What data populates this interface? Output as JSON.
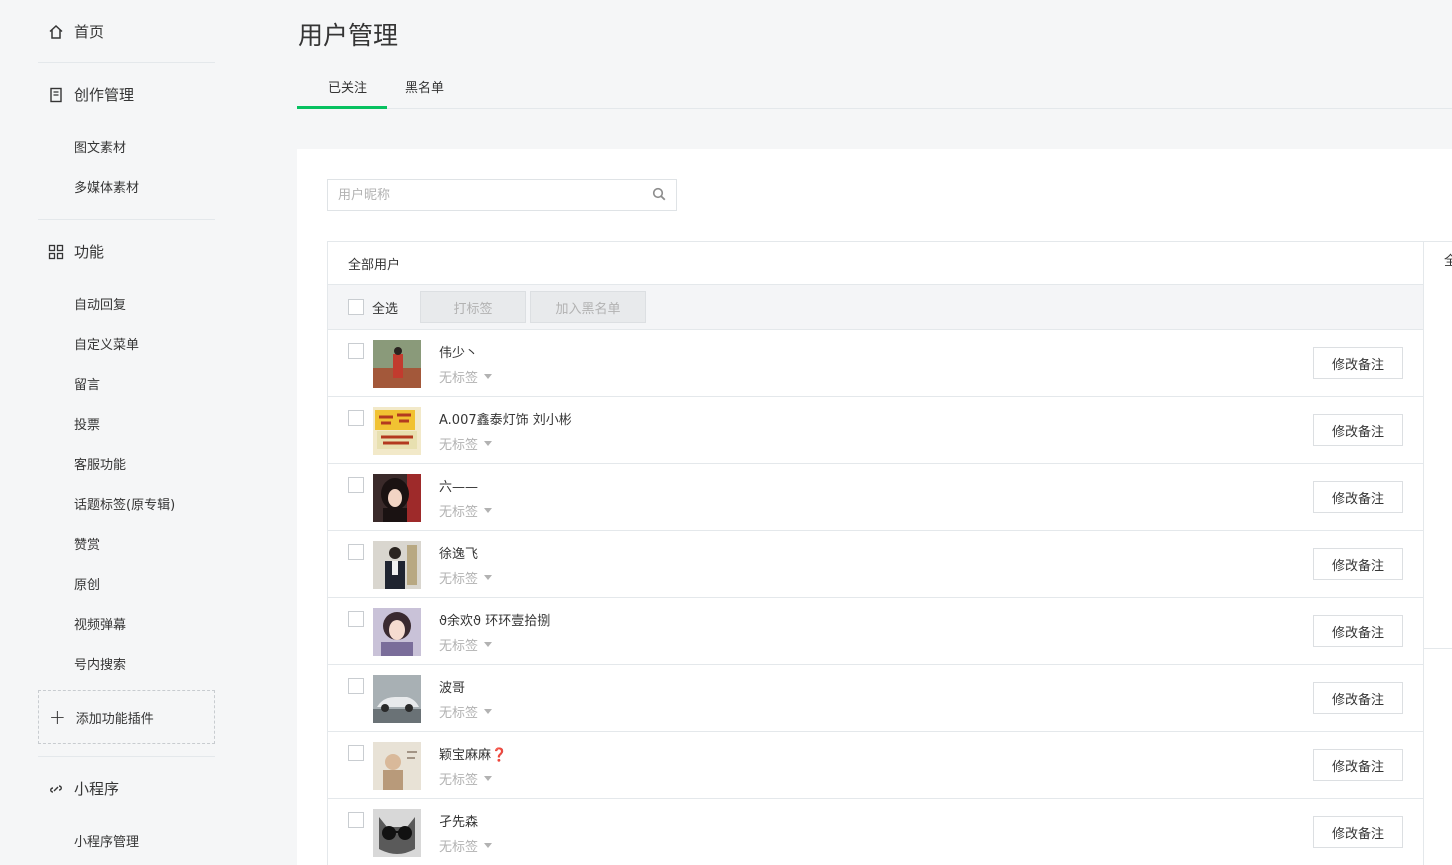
{
  "sidebar": {
    "home": "首页",
    "creation": {
      "label": "创作管理",
      "items": [
        "图文素材",
        "多媒体素材"
      ]
    },
    "features": {
      "label": "功能",
      "items": [
        "自动回复",
        "自定义菜单",
        "留言",
        "投票",
        "客服功能",
        "话题标签(原专辑)",
        "赞赏",
        "原创",
        "视频弹幕",
        "号内搜索"
      ]
    },
    "add_plugin": "添加功能插件",
    "miniprogram": {
      "label": "小程序",
      "items": [
        "小程序管理"
      ]
    }
  },
  "page": {
    "title": "用户管理",
    "tabs": [
      "已关注",
      "黑名单"
    ]
  },
  "search": {
    "placeholder": "用户昵称"
  },
  "list": {
    "header": "全部用户",
    "select_all": "全选",
    "tag_button": "打标签",
    "blacklist_button": "加入黑名单",
    "remark_button": "修改备注",
    "right_stub": "全",
    "users": [
      {
        "name": "伟少丶",
        "tag": "无标签"
      },
      {
        "name": "A.007鑫泰灯饰 刘小彬",
        "tag": "无标签"
      },
      {
        "name": "六——",
        "tag": "无标签"
      },
      {
        "name": "徐逸飞",
        "tag": "无标签"
      },
      {
        "name": "ϑ余欢ϑ 环环壹拾捌",
        "tag": "无标签"
      },
      {
        "name": "波哥",
        "tag": "无标签"
      },
      {
        "name": "颖宝麻麻❓",
        "tag": "无标签"
      },
      {
        "name": "孑先森",
        "tag": "无标签"
      }
    ]
  },
  "colors": {
    "accent": "#07c160",
    "text": "#353535",
    "muted": "#b2b2b2",
    "border": "#e4e8eb"
  }
}
